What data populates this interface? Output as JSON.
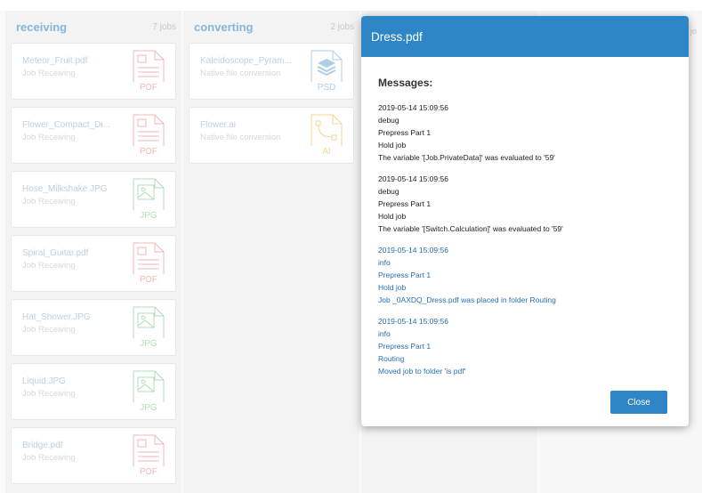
{
  "columns": [
    {
      "title": "receiving",
      "count": "7 jobs"
    },
    {
      "title": "converting",
      "count": "2 jobs"
    }
  ],
  "receiving_cards": [
    {
      "name": "Meteor_Fruit.pdf",
      "status": "Job Receiving",
      "filetype": "PDF",
      "icon": "pdf-file-icon"
    },
    {
      "name": "Flower_Compact_Di...",
      "status": "Job Receiving",
      "filetype": "PDF",
      "icon": "pdf-file-icon"
    },
    {
      "name": "Hose_Milkshake.JPG",
      "status": "Job Receiving",
      "filetype": "JPG",
      "icon": "image-file-icon"
    },
    {
      "name": "Spiral_Guitar.pdf",
      "status": "Job Receiving",
      "filetype": "PDF",
      "icon": "pdf-file-icon"
    },
    {
      "name": "Hat_Shower.JPG",
      "status": "Job Receiving",
      "filetype": "JPG",
      "icon": "image-file-icon"
    },
    {
      "name": "Liquid.JPG",
      "status": "Job Receiving",
      "filetype": "JPG",
      "icon": "image-file-icon"
    },
    {
      "name": "Bridge.pdf",
      "status": "Job Receiving",
      "filetype": "PDF",
      "icon": "pdf-file-icon"
    }
  ],
  "converting_cards": [
    {
      "name": "Kaleidoscope_Pyram...",
      "status": "Native file conversion",
      "filetype": "PSD",
      "icon": "layers-file-icon"
    },
    {
      "name": "Flower.ai",
      "status": "Native file conversion",
      "filetype": "AI",
      "icon": "vector-file-icon"
    }
  ],
  "edge_text": "jo",
  "colors": {
    "accent": "#2f86c6",
    "pdf": "#e88a8a",
    "jpg": "#7cc98a",
    "psd": "#7aaed6",
    "ai": "#f0b94e"
  },
  "modal": {
    "title": "Dress.pdf",
    "heading": "Messages:",
    "messages": [
      {
        "level": "debug",
        "lines": [
          "2019-05-14 15:09:56",
          "debug",
          "Prepress Part 1",
          "Hold job",
          "The variable '[Job.PrivateData]' was evaluated to '59'"
        ]
      },
      {
        "level": "debug",
        "lines": [
          "2019-05-14 15:09:56",
          "debug",
          "Prepress Part 1",
          "Hold job",
          "The variable '[Switch.Calculation]' was evaluated to '59'"
        ]
      },
      {
        "level": "info",
        "lines": [
          "2019-05-14 15:09:56",
          "info",
          "Prepress Part 1",
          "Hold job",
          "Job _0AXDQ_Dress.pdf was placed in folder Routing"
        ]
      },
      {
        "level": "info",
        "lines": [
          "2019-05-14 15:09:56",
          "info",
          "Prepress Part 1",
          "Routing",
          "Moved job to folder 'is pdf'"
        ]
      }
    ],
    "close_label": "Close"
  }
}
